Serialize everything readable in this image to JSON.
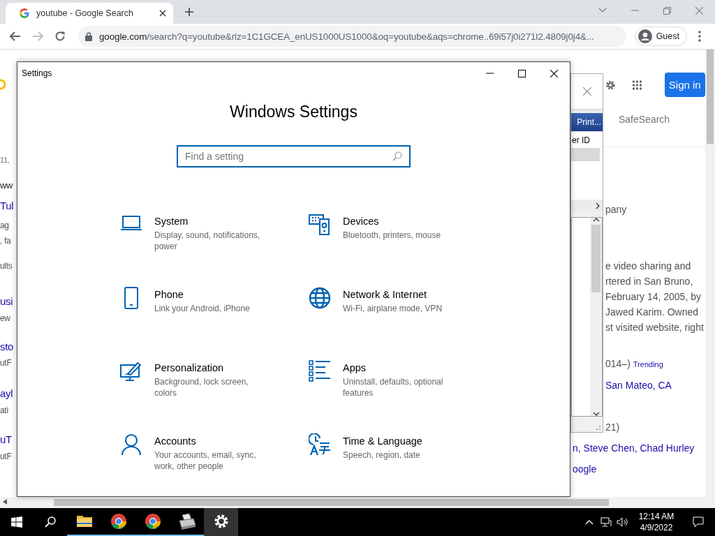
{
  "browser": {
    "tabs": [
      {
        "title": "youtube - Google Search",
        "selected": true
      }
    ],
    "toolbar": {
      "forward_disabled": true
    },
    "url": {
      "host": "google.com",
      "rest": "/search?q=youtube&rlz=1C1GCEA_enUS1000US1000&oq=youtube&aqs=chrome..69i57j0i271l2.4809j0j4&..."
    },
    "profile": "Guest"
  },
  "google_left": {
    "fragments": [
      {
        "text": "11,",
        "kind": "meta"
      },
      {
        "text": "ww",
        "kind": "url"
      },
      {
        "text": "Tul",
        "kind": "title"
      },
      {
        "text": "ag",
        "kind": "snippet"
      },
      {
        "text": ", fa",
        "kind": "snippet"
      },
      {
        "text": "ults",
        "kind": "snippet"
      },
      {
        "text": "usi",
        "kind": "title"
      },
      {
        "text": "ew",
        "kind": "snippet"
      },
      {
        "text": "sto",
        "kind": "title"
      },
      {
        "text": "utF",
        "kind": "snippet"
      },
      {
        "text": "ayl",
        "kind": "title"
      },
      {
        "text": "ati",
        "kind": "snippet"
      },
      {
        "text": "uT",
        "kind": "title"
      },
      {
        "text": "utF",
        "kind": "snippet"
      }
    ]
  },
  "google_right": {
    "sign_in": "Sign in",
    "safesearch": "SafeSearch",
    "lines": [
      {
        "parts": [
          {
            "text": "pany",
            "kind": "text"
          }
        ]
      },
      {
        "parts": [
          {
            "text": "e video sharing and",
            "kind": "text"
          }
        ]
      },
      {
        "parts": [
          {
            "text": "rtered in San Bruno,",
            "kind": "text"
          }
        ]
      },
      {
        "parts": [
          {
            "text": "February 14, 2005, by",
            "kind": "text"
          }
        ]
      },
      {
        "parts": [
          {
            "text": "Jawed Karim. Owned",
            "kind": "text"
          }
        ]
      },
      {
        "parts": [
          {
            "text": "st visited website, right",
            "kind": "text"
          }
        ]
      },
      {
        "parts": [
          {
            "text": "014–)",
            "kind": "text"
          },
          {
            "text": "Trending",
            "kind": "tag"
          }
        ]
      },
      {
        "parts": [
          {
            "text": "San Mateo, CA",
            "kind": "link"
          }
        ]
      },
      {
        "parts": [
          {
            "text": "21)",
            "kind": "text"
          }
        ]
      },
      {
        "parts": [
          {
            "text": "n, Steve Chen, Chad Hurley",
            "kind": "link"
          }
        ]
      },
      {
        "parts": [
          {
            "text": "oogle",
            "kind": "link"
          }
        ]
      }
    ]
  },
  "dialog": {
    "title_bar": "Print...",
    "column": "er ID"
  },
  "settings": {
    "title": "Settings",
    "heading": "Windows Settings",
    "search_placeholder": "Find a setting",
    "categories": [
      {
        "kind": "system",
        "name": "System",
        "description": "Display, sound, notifications, power"
      },
      {
        "kind": "devices",
        "name": "Devices",
        "description": "Bluetooth, printers, mouse"
      },
      {
        "kind": "phone",
        "name": "Phone",
        "description": "Link your Android, iPhone"
      },
      {
        "kind": "network",
        "name": "Network & Internet",
        "description": "Wi-Fi, airplane mode, VPN"
      },
      {
        "kind": "personalization",
        "name": "Personalization",
        "description": "Background, lock screen, colors"
      },
      {
        "kind": "apps",
        "name": "Apps",
        "description": "Uninstall, defaults, optional features"
      },
      {
        "kind": "accounts",
        "name": "Accounts",
        "description": "Your accounts, email, sync, work, other people"
      },
      {
        "kind": "time",
        "name": "Time & Language",
        "description": "Speech, region, date"
      }
    ]
  },
  "taskbar": {
    "apps": [
      {
        "kind": "explorer",
        "open": true,
        "selected": false
      },
      {
        "kind": "chrome",
        "open": true,
        "selected": false
      },
      {
        "kind": "chrome",
        "open": true,
        "selected": false
      },
      {
        "kind": "fax",
        "open": true,
        "selected": false
      },
      {
        "kind": "settings",
        "open": false,
        "selected": true
      }
    ],
    "clock": {
      "time": "12:14 AM",
      "date": "4/9/2022"
    }
  }
}
